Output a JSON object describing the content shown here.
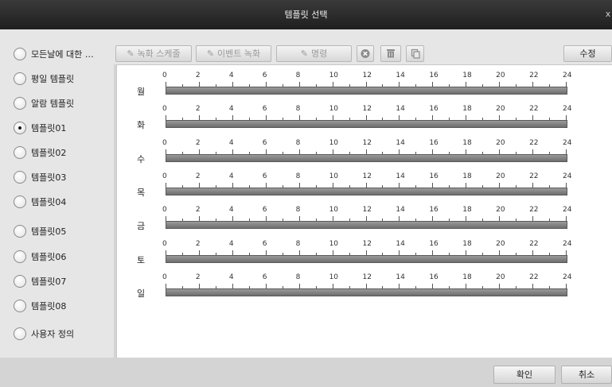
{
  "window": {
    "title": "템플릿 선택",
    "close_glyph": "x"
  },
  "templates": {
    "selected_index": 2,
    "items": [
      {
        "label": "모든날에 대한 …"
      },
      {
        "label": "평일 템플릿"
      },
      {
        "label": "알람 템플릿"
      },
      {
        "label": "템플릿01"
      },
      {
        "label": "템플릿02"
      },
      {
        "label": "템플릿03"
      },
      {
        "label": "템플릿04"
      },
      {
        "label": "템플릿05"
      },
      {
        "label": "템플릿06"
      },
      {
        "label": "템플릿07"
      },
      {
        "label": "템플릿08"
      },
      {
        "label": "사용자 정의"
      }
    ]
  },
  "toolbar": {
    "record_schedule": "녹화 스케줄",
    "event_record": "이벤트 녹화",
    "command": "명령",
    "delete_icon": "x-circle-icon",
    "clear_icon": "trash-icon",
    "copy_icon": "copy-icon",
    "edit": "수정"
  },
  "schedule": {
    "days": [
      "월",
      "화",
      "수",
      "목",
      "금",
      "토",
      "일"
    ],
    "hour_labels": [
      "0",
      "2",
      "4",
      "6",
      "8",
      "10",
      "12",
      "14",
      "16",
      "18",
      "20",
      "22",
      "24"
    ]
  },
  "footer": {
    "ok": "확인",
    "cancel": "취소"
  }
}
